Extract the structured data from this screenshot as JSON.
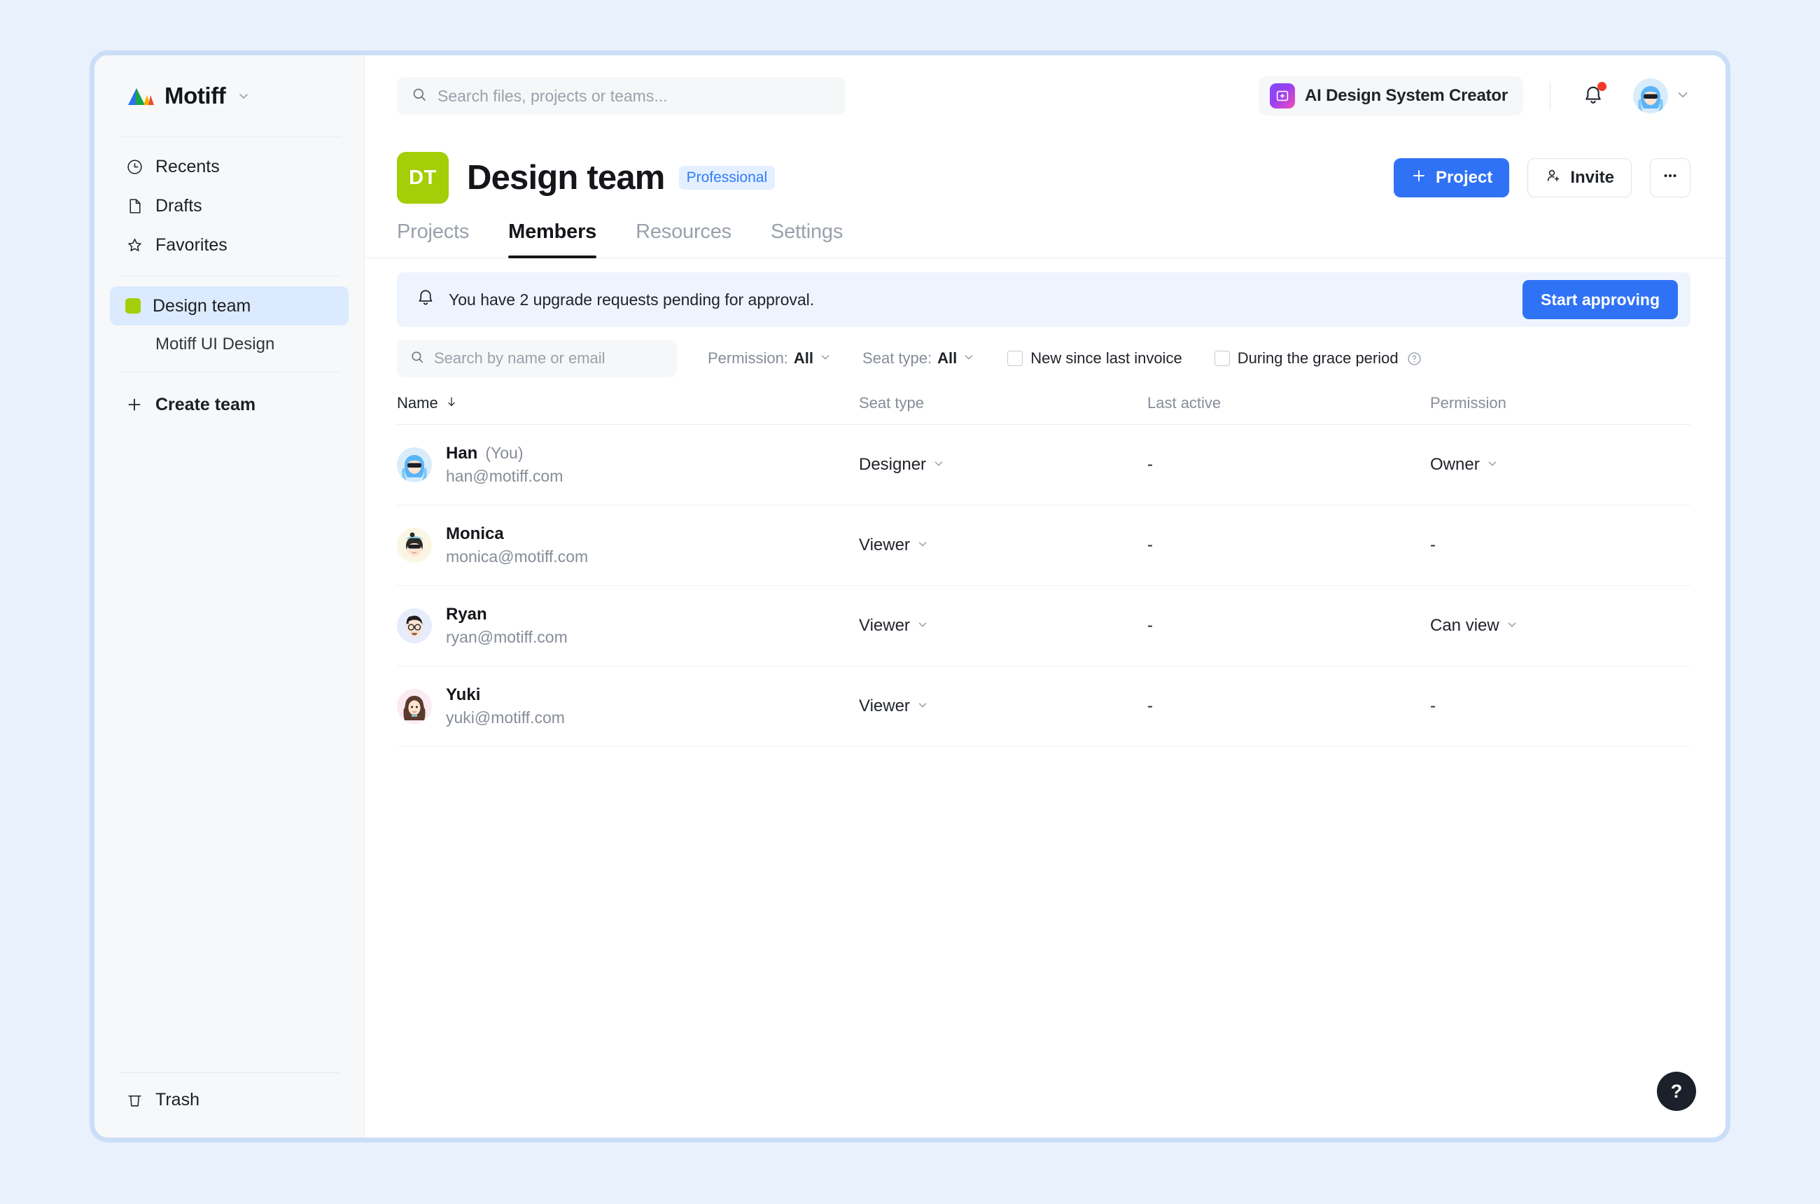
{
  "brand": {
    "name": "Motiff",
    "caret_icon": "chevron-down-icon"
  },
  "sidebar": {
    "items": [
      {
        "label": "Recents",
        "icon": "clock-icon"
      },
      {
        "label": "Drafts",
        "icon": "file-icon"
      },
      {
        "label": "Favorites",
        "icon": "star-icon"
      }
    ],
    "team": {
      "label": "Design team",
      "swatch_color": "#a4ce07",
      "active": true
    },
    "subitem": {
      "label": "Motiff UI Design"
    },
    "create_team": {
      "label": "Create team",
      "icon": "plus-icon"
    },
    "trash": {
      "label": "Trash",
      "icon": "trash-icon"
    }
  },
  "topbar": {
    "search": {
      "placeholder": "Search files, projects or teams...",
      "value": "",
      "icon": "search-icon"
    },
    "ai_chip": {
      "label": "AI Design System Creator",
      "icon": "ai-sparkle-icon"
    },
    "notifications": {
      "icon": "bell-icon",
      "has_unread": true,
      "dot_color": "#f5392b"
    },
    "account": {
      "icon": "avatar",
      "caret_icon": "chevron-down-icon"
    }
  },
  "page": {
    "team_initials": "DT",
    "team_avatar_color": "#a4ce07",
    "title": "Design team",
    "plan_badge": "Professional",
    "actions": {
      "project": "Project",
      "invite": "Invite",
      "more": "•••"
    }
  },
  "tabs": [
    {
      "label": "Projects",
      "active": false
    },
    {
      "label": "Members",
      "active": true
    },
    {
      "label": "Resources",
      "active": false
    },
    {
      "label": "Settings",
      "active": false
    }
  ],
  "banner": {
    "icon": "bell-icon",
    "message": "You have 2 upgrade requests pending for approval.",
    "action_label": "Start approving"
  },
  "filters": {
    "search": {
      "placeholder": "Search by name or email",
      "value": "",
      "icon": "search-icon"
    },
    "permission": {
      "key": "Permission:",
      "value": "All"
    },
    "seat_type": {
      "key": "Seat type:",
      "value": "All"
    },
    "new_since_invoice": {
      "label": "New since last invoice",
      "checked": false
    },
    "grace_period": {
      "label": "During the grace period",
      "checked": false,
      "help_icon": "question-circle-icon"
    }
  },
  "table": {
    "headers": {
      "name": "Name",
      "name_sort_icon": "arrow-down-icon",
      "seat_type": "Seat type",
      "last_active": "Last active",
      "permission": "Permission"
    },
    "rows": [
      {
        "name": "Han",
        "you_tag": "(You)",
        "email": "han@motiff.com",
        "seat_type": "Designer",
        "last_active": "-",
        "permission": "Owner",
        "permission_has_dropdown": true,
        "avatar": "han-avatar"
      },
      {
        "name": "Monica",
        "you_tag": "",
        "email": "monica@motiff.com",
        "seat_type": "Viewer",
        "last_active": "-",
        "permission": "-",
        "permission_has_dropdown": false,
        "avatar": "monica-avatar"
      },
      {
        "name": "Ryan",
        "you_tag": "",
        "email": "ryan@motiff.com",
        "seat_type": "Viewer",
        "last_active": "-",
        "permission": "Can view",
        "permission_has_dropdown": true,
        "avatar": "ryan-avatar"
      },
      {
        "name": "Yuki",
        "you_tag": "",
        "email": "yuki@motiff.com",
        "seat_type": "Viewer",
        "last_active": "-",
        "permission": "-",
        "permission_has_dropdown": false,
        "avatar": "yuki-avatar"
      }
    ]
  },
  "help_fab": {
    "label": "?"
  },
  "colors": {
    "accent": "#2f72f5",
    "brand_green": "#a4ce07",
    "page_bg": "#e9f1fd",
    "badge_bg": "#e4efff",
    "banner_bg": "#eef4fd"
  }
}
